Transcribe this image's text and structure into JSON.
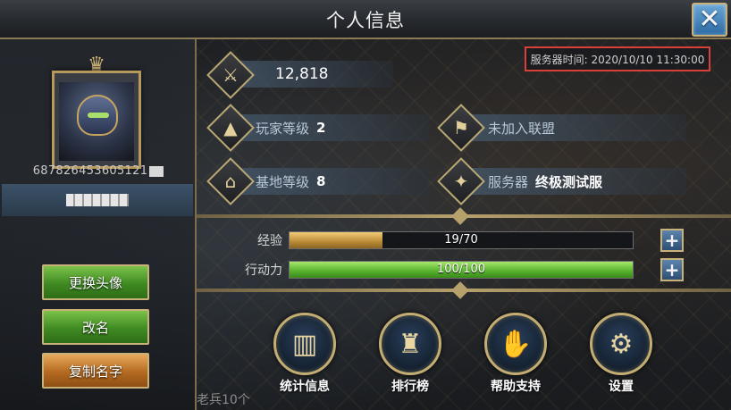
{
  "window": {
    "title": "个人信息",
    "close_icon": "close-icon"
  },
  "profile": {
    "player_id": "687826453605121",
    "change_avatar_label": "更换头像",
    "rename_label": "改名",
    "copy_name_label": "复制名字"
  },
  "server_time": "服务器时间: 2020/10/10 11:30:00",
  "stats": {
    "power": {
      "icon": "crossed-swords-icon",
      "value": "12,818"
    },
    "player_level": {
      "icon": "player-level-icon",
      "label": "玩家等级",
      "value": "2"
    },
    "alliance": {
      "icon": "alliance-banner-icon",
      "label": "未加入联盟"
    },
    "base_level": {
      "icon": "base-level-icon",
      "label": "基地等级",
      "value": "8"
    },
    "server": {
      "icon": "server-icon",
      "label": "服务器",
      "value": "终极测试服"
    }
  },
  "progress": {
    "experience": {
      "label": "经验",
      "text": "19/70",
      "current": 19,
      "max": 70
    },
    "action_power": {
      "label": "行动力",
      "text": "100/100",
      "current": 100,
      "max": 100
    }
  },
  "actions": [
    {
      "label": "统计信息",
      "icon": "statistics-icon"
    },
    {
      "label": "排行榜",
      "icon": "leaderboard-icon"
    },
    {
      "label": "帮助支持",
      "icon": "handshake-icon"
    },
    {
      "label": "设置",
      "icon": "gear-icon"
    }
  ],
  "footer_text": "老兵10个",
  "colors": {
    "experience_fill": "#c99a42",
    "action_power_fill": "#6cc23a",
    "server_time_border": "#d8413a",
    "gold_trim": "#c9b27a"
  }
}
